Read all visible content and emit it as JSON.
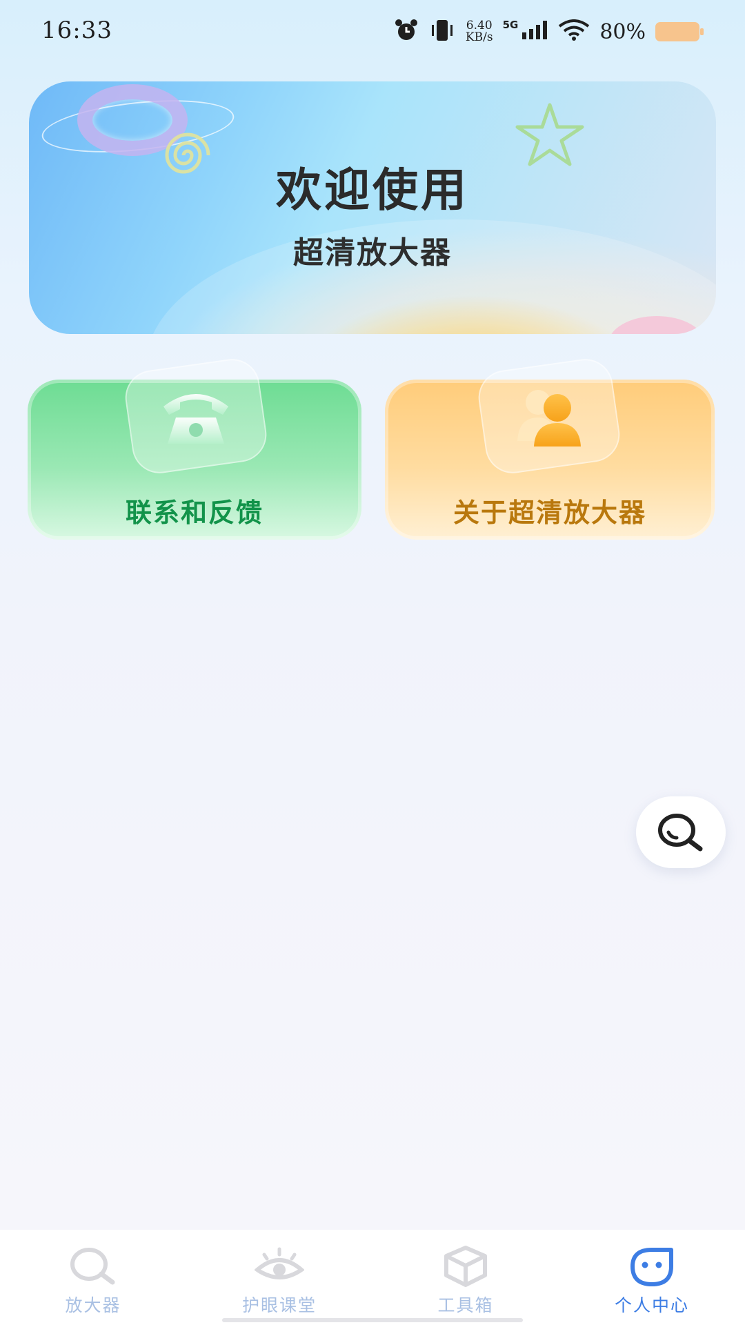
{
  "status_bar": {
    "time": "16:33",
    "net_speed_value": "6.40",
    "net_speed_unit": "KB/s",
    "network": "5G",
    "battery": "80%"
  },
  "banner": {
    "title": "欢迎使用",
    "subtitle": "超清放大器"
  },
  "cards": {
    "contact": {
      "label": "联系和反馈",
      "icon": "telephone-icon",
      "color": "#12934a"
    },
    "about": {
      "label": "关于超清放大器",
      "icon": "users-icon",
      "color": "#b9780d"
    }
  },
  "fab": {
    "icon": "search-icon"
  },
  "bottom_nav": {
    "active_color": "#3d7de4",
    "inactive_color": "#a9c0e3",
    "items": [
      {
        "label": "放大器",
        "icon": "search-icon"
      },
      {
        "label": "护眼课堂",
        "icon": "eye-icon"
      },
      {
        "label": "工具箱",
        "icon": "box-icon"
      },
      {
        "label": "个人中心",
        "icon": "face-icon",
        "active": true
      }
    ]
  }
}
